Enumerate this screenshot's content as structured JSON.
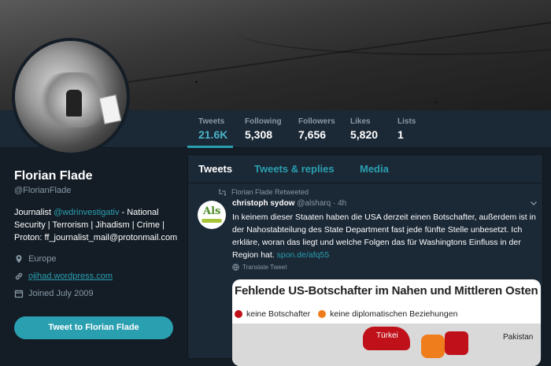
{
  "profile": {
    "name": "Florian Flade",
    "handle": "@FlorianFlade",
    "bio_prefix": "Journalist ",
    "bio_mention": "@wdrinvestigativ",
    "bio_suffix": " - National Security | Terrorism | Jihadism | Crime | Proton: ff_journalist_mail@protonmail.com",
    "location": "Europe",
    "website": "ojihad.wordpress.com",
    "joined": "Joined July 2009",
    "tweet_to_label": "Tweet to Florian Flade"
  },
  "stats": [
    {
      "label": "Tweets",
      "value": "21.6K"
    },
    {
      "label": "Following",
      "value": "5,308"
    },
    {
      "label": "Followers",
      "value": "7,656"
    },
    {
      "label": "Likes",
      "value": "5,820"
    },
    {
      "label": "Lists",
      "value": "1"
    }
  ],
  "timeline": {
    "tabs": [
      "Tweets",
      "Tweets & replies",
      "Media"
    ],
    "retweet_note": "Florian Flade Retweeted",
    "tweet": {
      "author": "christoph sydow",
      "handle": "@alsharq",
      "time": "· 4h",
      "avatar_text": "Als",
      "body": "In keinem dieser Staaten haben die USA derzeit einen Botschafter, außerdem ist in der Nahostabteilung des State Department fast jede fünfte Stelle unbesetzt. Ich erkläre, woran das liegt und welche Folgen das für Washingtons Einfluss in der Region hat. ",
      "link": "spon.de/afq55",
      "translate": "Translate Tweet",
      "media": {
        "title": "Fehlende US-Botschafter im Nahen und Mittleren Osten",
        "legend_red": "keine Botschafter",
        "legend_orange": "keine diplomatischen Beziehungen",
        "label_turkei": "Türkei",
        "label_pakistan": "Pakistan",
        "red_color": "#c0111a",
        "orange_color": "#ef7d1c"
      }
    }
  },
  "colors": {
    "accent": "#2a9fb0",
    "background": "#141d26",
    "panel": "#1b2836",
    "muted": "#8899a6"
  }
}
